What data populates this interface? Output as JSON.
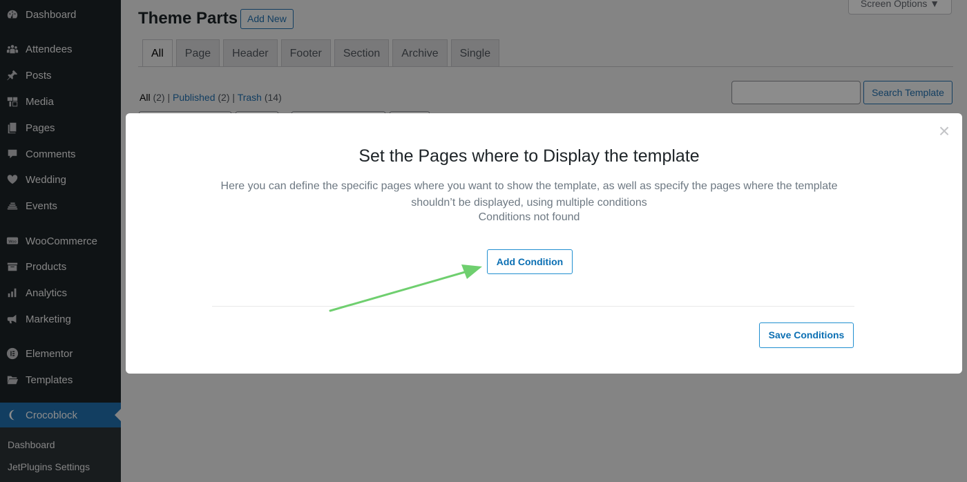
{
  "sidebar": {
    "items": [
      {
        "label": "Dashboard",
        "icon": "dashboard-icon"
      },
      {
        "label": "Attendees",
        "icon": "groups-icon"
      },
      {
        "label": "Posts",
        "icon": "pin-icon"
      },
      {
        "label": "Media",
        "icon": "media-icon"
      },
      {
        "label": "Pages",
        "icon": "page-icon"
      },
      {
        "label": "Comments",
        "icon": "comment-icon"
      },
      {
        "label": "Wedding",
        "icon": "heart-icon"
      },
      {
        "label": "Events",
        "icon": "events-icon"
      },
      {
        "label": "WooCommerce",
        "icon": "woo-icon"
      },
      {
        "label": "Products",
        "icon": "archive-icon"
      },
      {
        "label": "Analytics",
        "icon": "bar-chart-icon"
      },
      {
        "label": "Marketing",
        "icon": "megaphone-icon"
      },
      {
        "label": "Elementor",
        "icon": "elementor-icon"
      },
      {
        "label": "Templates",
        "icon": "folder-icon"
      },
      {
        "label": "Crocoblock",
        "icon": "crocoblock-icon"
      }
    ],
    "submenu": [
      "Dashboard",
      "JetPlugins Settings"
    ]
  },
  "header": {
    "title": "Theme Parts",
    "add_new": "Add New",
    "screen_options": "Screen Options ▼"
  },
  "tabs": [
    "All",
    "Page",
    "Header",
    "Footer",
    "Section",
    "Archive",
    "Single"
  ],
  "filters": {
    "all": "All",
    "all_count": "(2)",
    "published": "Published",
    "published_count": "(2)",
    "trash": "Trash",
    "trash_count": "(14)",
    "sep": "|"
  },
  "search": {
    "button": "Search Template",
    "value": ""
  },
  "modal": {
    "title": "Set the Pages where to Display the template",
    "description": "Here you can define the specific pages where you want to show the template, as well as specify the pages where the template shouldn’t be displayed, using multiple conditions",
    "empty": "Conditions not found",
    "add_condition": "Add Condition",
    "save_conditions": "Save Conditions",
    "close": "×"
  },
  "colors": {
    "accent": "#2271b1",
    "sidebar_bg": "#1d2327",
    "arrow": "#6fcf6f"
  }
}
